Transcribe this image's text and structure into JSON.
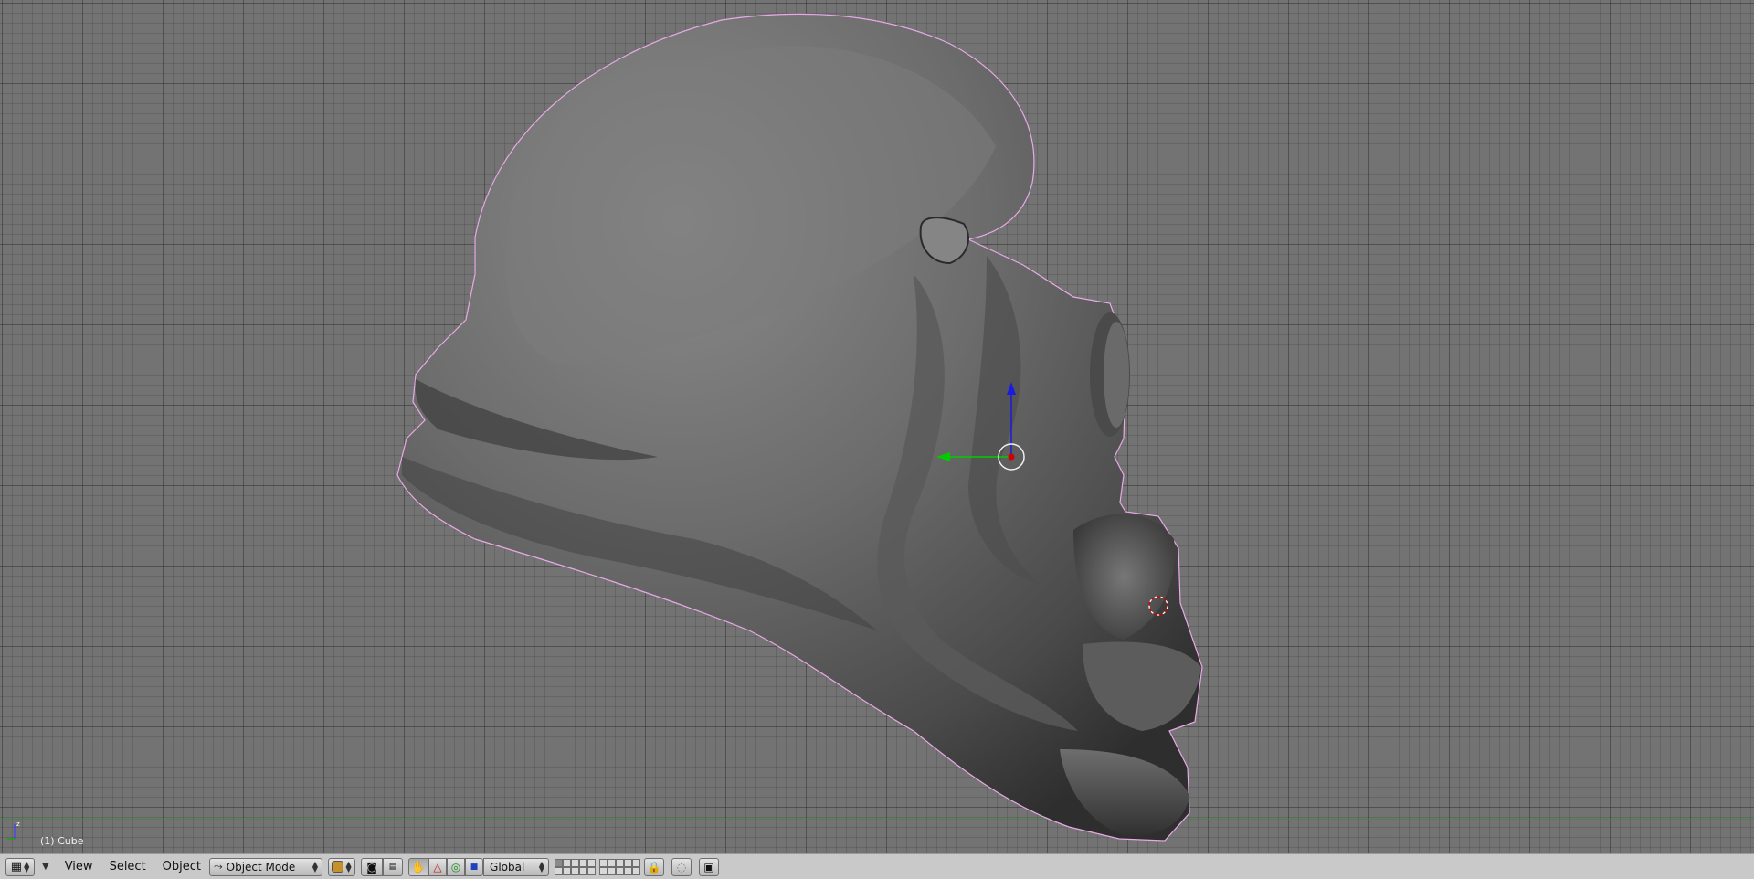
{
  "viewport": {
    "object_label": "(1) Cube",
    "axis_label": "z",
    "object_name": "Cube"
  },
  "header": {
    "editor_type_icon": "grid-icon",
    "menus": [
      "View",
      "Select",
      "Object"
    ],
    "mode_label": "Object Mode",
    "mode_icon": "object-mode-icon",
    "draw_type_icon": "shaded-draw-icon",
    "pivot_icon": "pivot-icon",
    "transform_orientation": "Global",
    "manipulator_icons": [
      "hand-icon",
      "translate-icon",
      "rotate-icon",
      "scale-icon"
    ],
    "layer_count": 20,
    "lock_icon": "lock-icon",
    "render_icon": "render-icon"
  },
  "colors": {
    "viewport_bg": "#737373",
    "header_bg": "#c9c9c9",
    "selection_outline": "#e9a9e6",
    "x_axis": "#d00000",
    "y_axis": "#00cc00",
    "z_axis": "#1a1ae0"
  }
}
